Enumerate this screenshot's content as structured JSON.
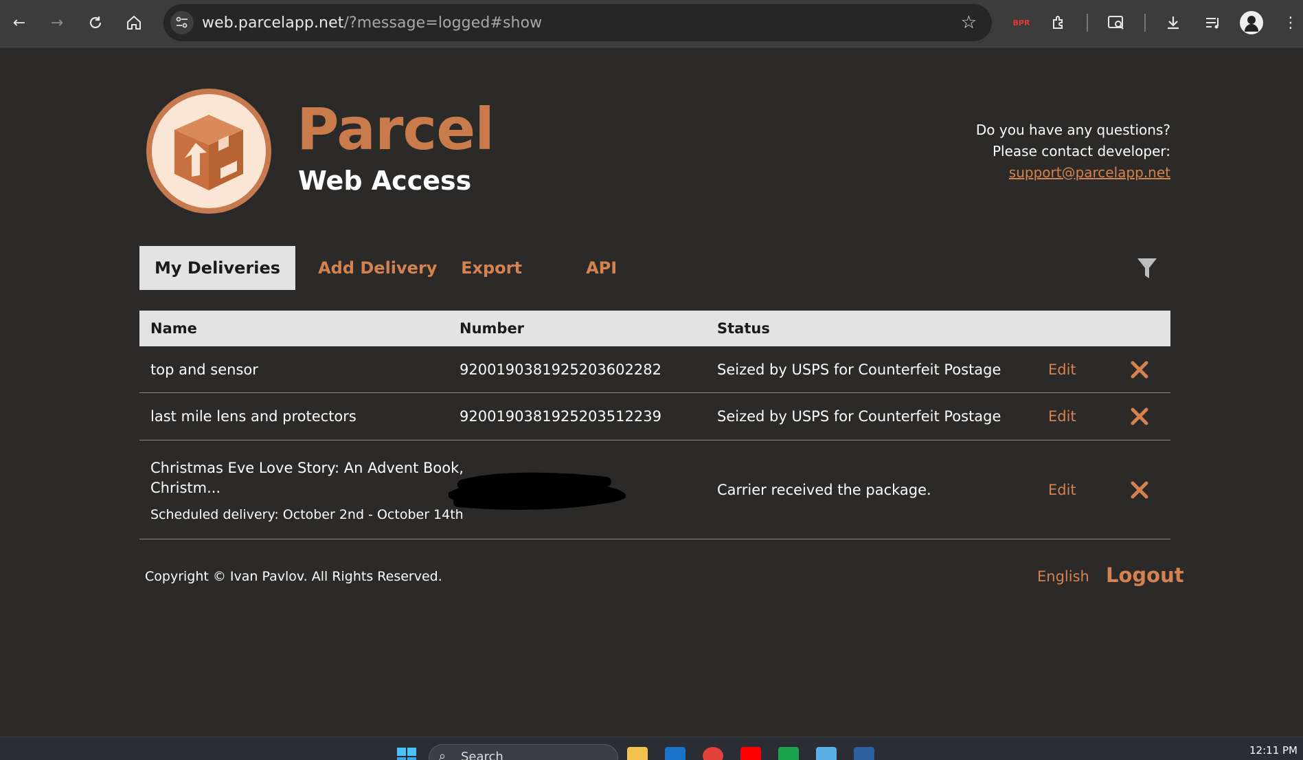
{
  "browser": {
    "url_host": "web.parcelapp.net",
    "url_path": "/?message=logged#show"
  },
  "brand": {
    "title": "Parcel",
    "subtitle": "Web Access"
  },
  "contact": {
    "line1": "Do you have any questions?",
    "line2": "Please contact developer:",
    "email": "support@parcelapp.net"
  },
  "tabs": [
    {
      "label": "My Deliveries",
      "active": true
    },
    {
      "label": "Add Delivery",
      "active": false
    },
    {
      "label": "Export",
      "active": false
    },
    {
      "label": "API",
      "active": false
    }
  ],
  "table": {
    "headers": [
      "Name",
      "Number",
      "Status"
    ],
    "edit_label": "Edit",
    "rows": [
      {
        "name": "top and sensor",
        "number": "9200190381925203602282",
        "status": "Seized by USPS for Counterfeit Postage",
        "note": ""
      },
      {
        "name": "last mile lens and protectors",
        "number": "9200190381925203512239",
        "status": "Seized by USPS for Counterfeit Postage",
        "note": ""
      },
      {
        "name_line1": "Christmas Eve Love Story: An Advent Book,",
        "name_line2": "Christm...",
        "number": "",
        "status": "Carrier received the package.",
        "note": "Scheduled delivery: October 2nd - October 14th"
      }
    ]
  },
  "footer": {
    "copyright": "Copyright © Ivan Pavlov. All Rights Reserved.",
    "language": "English",
    "logout": "Logout"
  },
  "taskbar": {
    "search_label": "Search",
    "clock": "12:11 PM"
  },
  "colors": {
    "accent": "#d4824f",
    "background": "#2b2a29",
    "header_bg": "#e3e3e3"
  }
}
